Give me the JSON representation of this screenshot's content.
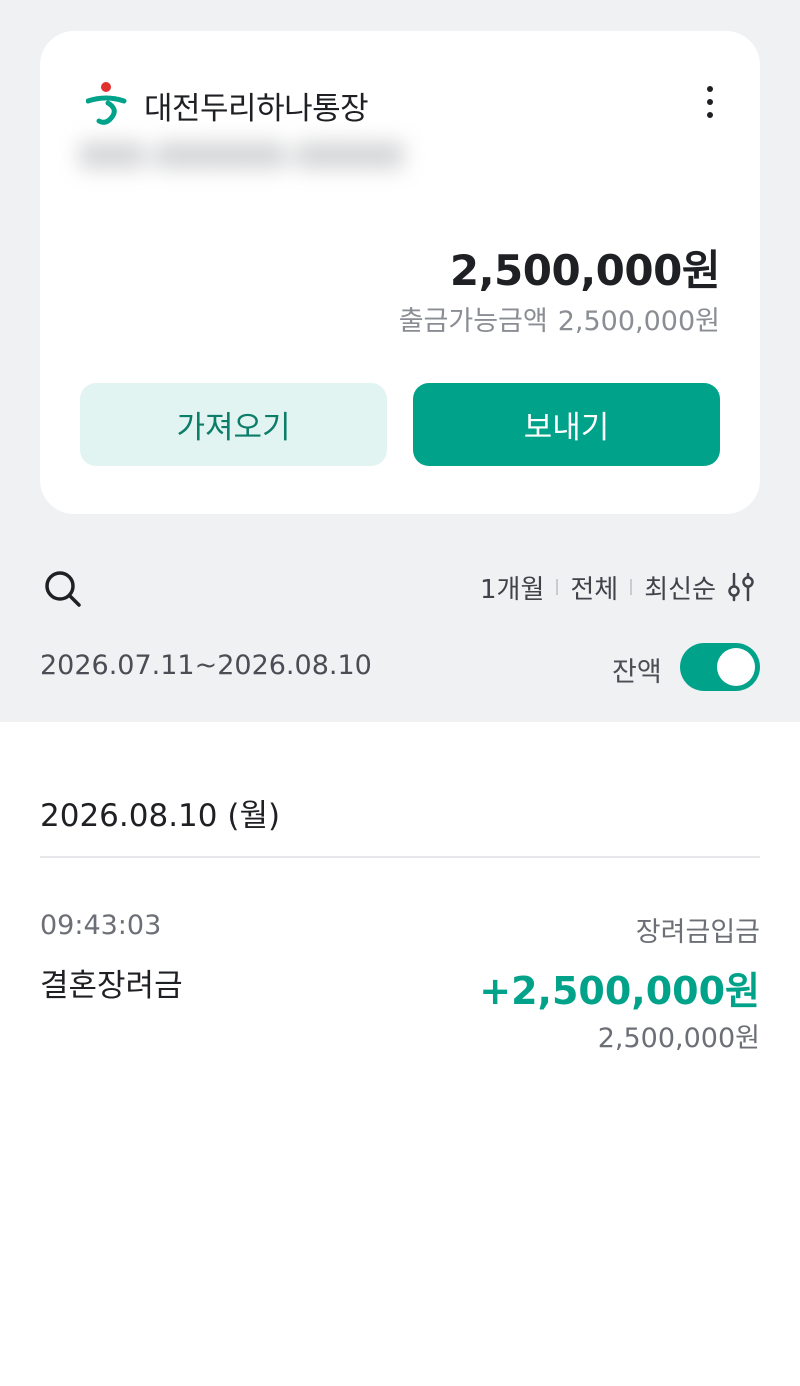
{
  "account": {
    "name": "대전두리하나통장",
    "number": "000-000000-00000",
    "balance": "2,500,000원",
    "available_label": "출금가능금액",
    "available_amount": "2,500,000원",
    "fetch_label": "가져오기",
    "send_label": "보내기"
  },
  "filters": {
    "period": "1개월",
    "type": "전체",
    "order": "최신순"
  },
  "date_range": "2026.07.11~2026.08.10",
  "balance_toggle": {
    "label": "잔액",
    "on": true
  },
  "transactions": [
    {
      "date": "2026.08.10 (월)",
      "time": "09:43:03",
      "name": "결혼장려금",
      "type": "장려금입금",
      "amount": "+2,500,000원",
      "balance": "2,500,000원"
    }
  ],
  "colors": {
    "accent": "#00a38a",
    "accent_light": "#e2f4f1",
    "background": "#f0f1f3"
  }
}
